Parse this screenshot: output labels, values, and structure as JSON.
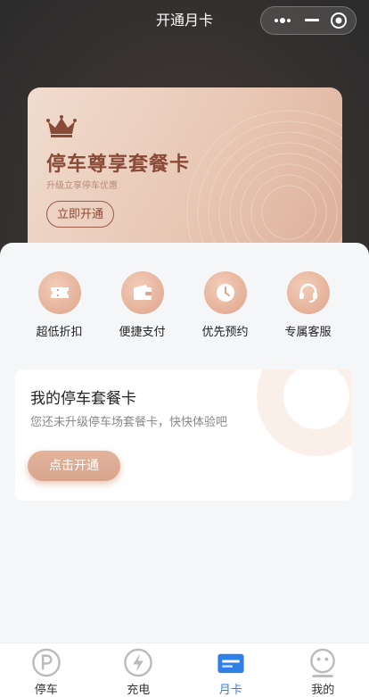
{
  "nav": {
    "title": "开通月卡"
  },
  "vip_card": {
    "title": "停车尊享套餐卡",
    "subtitle": "升级立享停车优惠",
    "button": "立即开通"
  },
  "features": [
    {
      "label": "超低折扣",
      "icon": "ticket-icon"
    },
    {
      "label": "便捷支付",
      "icon": "wallet-icon"
    },
    {
      "label": "优先预约",
      "icon": "clock-icon"
    },
    {
      "label": "专属客服",
      "icon": "headset-icon"
    }
  ],
  "my_card": {
    "title": "我的停车套餐卡",
    "description": "您还未升级停车场套餐卡，快快体验吧",
    "button": "点击开通"
  },
  "tabbar": {
    "active_color": "#2f7fe8",
    "items": [
      {
        "label": "停车",
        "icon": "parking-icon"
      },
      {
        "label": "充电",
        "icon": "lightning-icon"
      },
      {
        "label": "月卡",
        "icon": "card-icon",
        "active": true
      },
      {
        "label": "我的",
        "icon": "face-icon"
      }
    ]
  },
  "colors": {
    "accent": "#d9a58c",
    "brand_dark": "#8a4a38"
  }
}
